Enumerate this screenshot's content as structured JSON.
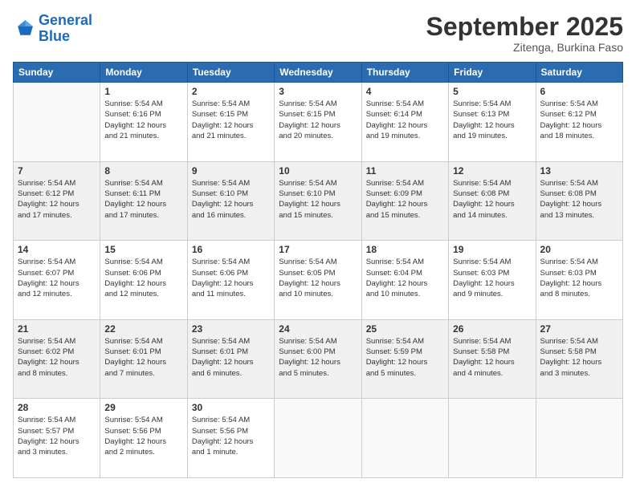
{
  "logo": {
    "line1": "General",
    "line2": "Blue"
  },
  "header": {
    "month_title": "September 2025",
    "subtitle": "Zitenga, Burkina Faso"
  },
  "days_of_week": [
    "Sunday",
    "Monday",
    "Tuesday",
    "Wednesday",
    "Thursday",
    "Friday",
    "Saturday"
  ],
  "weeks": [
    [
      {
        "day": "",
        "info": ""
      },
      {
        "day": "1",
        "info": "Sunrise: 5:54 AM\nSunset: 6:16 PM\nDaylight: 12 hours\nand 21 minutes."
      },
      {
        "day": "2",
        "info": "Sunrise: 5:54 AM\nSunset: 6:15 PM\nDaylight: 12 hours\nand 21 minutes."
      },
      {
        "day": "3",
        "info": "Sunrise: 5:54 AM\nSunset: 6:15 PM\nDaylight: 12 hours\nand 20 minutes."
      },
      {
        "day": "4",
        "info": "Sunrise: 5:54 AM\nSunset: 6:14 PM\nDaylight: 12 hours\nand 19 minutes."
      },
      {
        "day": "5",
        "info": "Sunrise: 5:54 AM\nSunset: 6:13 PM\nDaylight: 12 hours\nand 19 minutes."
      },
      {
        "day": "6",
        "info": "Sunrise: 5:54 AM\nSunset: 6:12 PM\nDaylight: 12 hours\nand 18 minutes."
      }
    ],
    [
      {
        "day": "7",
        "info": "Sunrise: 5:54 AM\nSunset: 6:12 PM\nDaylight: 12 hours\nand 17 minutes."
      },
      {
        "day": "8",
        "info": "Sunrise: 5:54 AM\nSunset: 6:11 PM\nDaylight: 12 hours\nand 17 minutes."
      },
      {
        "day": "9",
        "info": "Sunrise: 5:54 AM\nSunset: 6:10 PM\nDaylight: 12 hours\nand 16 minutes."
      },
      {
        "day": "10",
        "info": "Sunrise: 5:54 AM\nSunset: 6:10 PM\nDaylight: 12 hours\nand 15 minutes."
      },
      {
        "day": "11",
        "info": "Sunrise: 5:54 AM\nSunset: 6:09 PM\nDaylight: 12 hours\nand 15 minutes."
      },
      {
        "day": "12",
        "info": "Sunrise: 5:54 AM\nSunset: 6:08 PM\nDaylight: 12 hours\nand 14 minutes."
      },
      {
        "day": "13",
        "info": "Sunrise: 5:54 AM\nSunset: 6:08 PM\nDaylight: 12 hours\nand 13 minutes."
      }
    ],
    [
      {
        "day": "14",
        "info": "Sunrise: 5:54 AM\nSunset: 6:07 PM\nDaylight: 12 hours\nand 12 minutes."
      },
      {
        "day": "15",
        "info": "Sunrise: 5:54 AM\nSunset: 6:06 PM\nDaylight: 12 hours\nand 12 minutes."
      },
      {
        "day": "16",
        "info": "Sunrise: 5:54 AM\nSunset: 6:06 PM\nDaylight: 12 hours\nand 11 minutes."
      },
      {
        "day": "17",
        "info": "Sunrise: 5:54 AM\nSunset: 6:05 PM\nDaylight: 12 hours\nand 10 minutes."
      },
      {
        "day": "18",
        "info": "Sunrise: 5:54 AM\nSunset: 6:04 PM\nDaylight: 12 hours\nand 10 minutes."
      },
      {
        "day": "19",
        "info": "Sunrise: 5:54 AM\nSunset: 6:03 PM\nDaylight: 12 hours\nand 9 minutes."
      },
      {
        "day": "20",
        "info": "Sunrise: 5:54 AM\nSunset: 6:03 PM\nDaylight: 12 hours\nand 8 minutes."
      }
    ],
    [
      {
        "day": "21",
        "info": "Sunrise: 5:54 AM\nSunset: 6:02 PM\nDaylight: 12 hours\nand 8 minutes."
      },
      {
        "day": "22",
        "info": "Sunrise: 5:54 AM\nSunset: 6:01 PM\nDaylight: 12 hours\nand 7 minutes."
      },
      {
        "day": "23",
        "info": "Sunrise: 5:54 AM\nSunset: 6:01 PM\nDaylight: 12 hours\nand 6 minutes."
      },
      {
        "day": "24",
        "info": "Sunrise: 5:54 AM\nSunset: 6:00 PM\nDaylight: 12 hours\nand 5 minutes."
      },
      {
        "day": "25",
        "info": "Sunrise: 5:54 AM\nSunset: 5:59 PM\nDaylight: 12 hours\nand 5 minutes."
      },
      {
        "day": "26",
        "info": "Sunrise: 5:54 AM\nSunset: 5:58 PM\nDaylight: 12 hours\nand 4 minutes."
      },
      {
        "day": "27",
        "info": "Sunrise: 5:54 AM\nSunset: 5:58 PM\nDaylight: 12 hours\nand 3 minutes."
      }
    ],
    [
      {
        "day": "28",
        "info": "Sunrise: 5:54 AM\nSunset: 5:57 PM\nDaylight: 12 hours\nand 3 minutes."
      },
      {
        "day": "29",
        "info": "Sunrise: 5:54 AM\nSunset: 5:56 PM\nDaylight: 12 hours\nand 2 minutes."
      },
      {
        "day": "30",
        "info": "Sunrise: 5:54 AM\nSunset: 5:56 PM\nDaylight: 12 hours\nand 1 minute."
      },
      {
        "day": "",
        "info": ""
      },
      {
        "day": "",
        "info": ""
      },
      {
        "day": "",
        "info": ""
      },
      {
        "day": "",
        "info": ""
      }
    ]
  ]
}
